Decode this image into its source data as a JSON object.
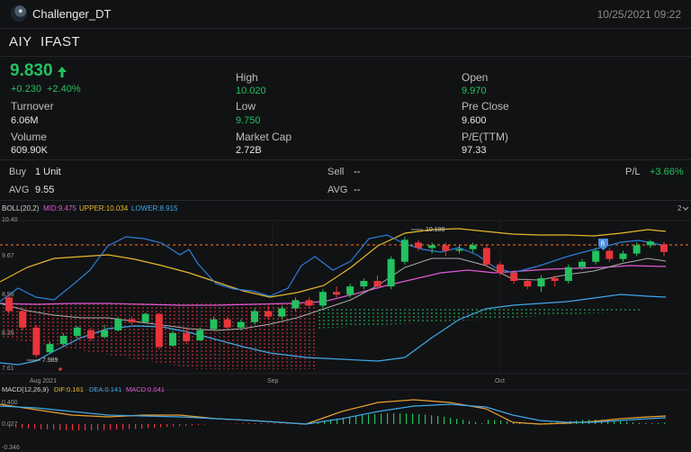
{
  "header": {
    "app_name": "Challenger_DT",
    "datetime": "10/25/2021 09:22"
  },
  "stock": {
    "symbol": "AIY",
    "name": "IFAST",
    "price": "9.830",
    "change": "+0.230",
    "change_pct": "+2.40%",
    "colors": {
      "up": "#23c160",
      "down": "#e8353b"
    }
  },
  "stats": {
    "turnover_label": "Turnover",
    "turnover": "6.06M",
    "volume_label": "Volume",
    "volume": "609.90K",
    "high_label": "High",
    "high": "10.020",
    "low_label": "Low",
    "low": "9.750",
    "mktcap_label": "Market Cap",
    "mktcap": "2.72B",
    "open_label": "Open",
    "open": "9.970",
    "preclose_label": "Pre Close",
    "preclose": "9.600",
    "pe_label": "P/E(TTM)",
    "pe": "97.33"
  },
  "position": {
    "buy_label": "Buy",
    "buy_value": "1 Unit",
    "avg_label": "AVG",
    "avg_value": "9.55",
    "sell_label": "Sell",
    "sell_value": "--",
    "avg2_label": "AVG",
    "avg2_value": "--",
    "pl_label": "P/L",
    "pl_value": "+3.66%"
  },
  "chart_data": {
    "type": "candlestick",
    "indicator": {
      "name": "BOLL(20,2)",
      "mid": "MID:9.475",
      "upper": "UPPER:10.034",
      "lower": "LOWER:8.915"
    },
    "y_ticks": [
      "10.40",
      "9.67",
      "8.98",
      "8.35",
      "7.61"
    ],
    "x_labels": [
      "Aug 2021",
      "Sep",
      "Oct"
    ],
    "annotations": {
      "high_marker": "10.100",
      "low_marker": "7.989",
      "buy_marker": "B",
      "page": "2"
    },
    "macd": {
      "name": "MACD(12,26,9)",
      "dif": "DIF:0.161",
      "dea": "DEA:0.141",
      "macd": "MACD:0.041",
      "y_ticks": [
        "0.400",
        "0.027",
        "-0.346"
      ]
    },
    "candles": [
      [
        9.0,
        8.75,
        9.05,
        8.7
      ],
      [
        8.75,
        8.45,
        8.8,
        8.4
      ],
      [
        8.45,
        7.95,
        8.5,
        7.9
      ],
      [
        8.0,
        8.15,
        8.2,
        7.98
      ],
      [
        8.15,
        8.3,
        8.35,
        8.1
      ],
      [
        8.3,
        8.45,
        8.48,
        8.25
      ],
      [
        8.4,
        8.25,
        8.45,
        8.2
      ],
      [
        8.28,
        8.4,
        8.5,
        8.25
      ],
      [
        8.4,
        8.6,
        8.65,
        8.38
      ],
      [
        8.6,
        8.55,
        8.65,
        8.5
      ],
      [
        8.55,
        8.7,
        8.72,
        8.52
      ],
      [
        8.7,
        8.1,
        8.72,
        8.05
      ],
      [
        8.12,
        8.35,
        8.4,
        8.1
      ],
      [
        8.35,
        8.2,
        8.45,
        8.15
      ],
      [
        8.22,
        8.4,
        8.45,
        8.2
      ],
      [
        8.42,
        8.6,
        8.65,
        8.4
      ],
      [
        8.6,
        8.45,
        8.65,
        8.42
      ],
      [
        8.45,
        8.55,
        8.6,
        8.4
      ],
      [
        8.55,
        8.75,
        8.8,
        8.5
      ],
      [
        8.75,
        8.65,
        8.85,
        8.6
      ],
      [
        8.65,
        8.8,
        8.85,
        8.6
      ],
      [
        8.8,
        8.95,
        9.0,
        8.75
      ],
      [
        8.95,
        8.85,
        9.0,
        8.8
      ],
      [
        8.85,
        9.1,
        9.15,
        8.8
      ],
      [
        9.1,
        9.05,
        9.2,
        9.0
      ],
      [
        9.05,
        9.2,
        9.25,
        9.0
      ],
      [
        9.2,
        9.3,
        9.35,
        9.15
      ],
      [
        9.3,
        9.2,
        9.4,
        9.15
      ],
      [
        9.2,
        9.7,
        9.75,
        9.15
      ],
      [
        9.65,
        10.05,
        10.1,
        9.6
      ],
      [
        10.0,
        9.9,
        10.05,
        9.85
      ],
      [
        9.9,
        9.95,
        10.0,
        9.8
      ],
      [
        9.95,
        9.85,
        10.0,
        9.75
      ],
      [
        9.85,
        9.88,
        9.95,
        9.8
      ],
      [
        9.88,
        9.95,
        10.0,
        9.82
      ],
      [
        9.9,
        9.6,
        9.95,
        9.55
      ],
      [
        9.6,
        9.45,
        9.65,
        9.4
      ],
      [
        9.45,
        9.3,
        9.5,
        9.25
      ],
      [
        9.3,
        9.2,
        9.35,
        9.15
      ],
      [
        9.2,
        9.35,
        9.4,
        9.1
      ],
      [
        9.35,
        9.3,
        9.4,
        9.2
      ],
      [
        9.3,
        9.55,
        9.6,
        9.25
      ],
      [
        9.55,
        9.65,
        9.7,
        9.5
      ],
      [
        9.65,
        9.85,
        9.9,
        9.6
      ],
      [
        9.85,
        9.7,
        9.9,
        9.65
      ],
      [
        9.7,
        9.8,
        9.85,
        9.65
      ],
      [
        9.8,
        9.95,
        10.0,
        9.75
      ],
      [
        9.95,
        10.02,
        10.05,
        9.9
      ],
      [
        9.97,
        9.83,
        10.02,
        9.75
      ]
    ]
  }
}
